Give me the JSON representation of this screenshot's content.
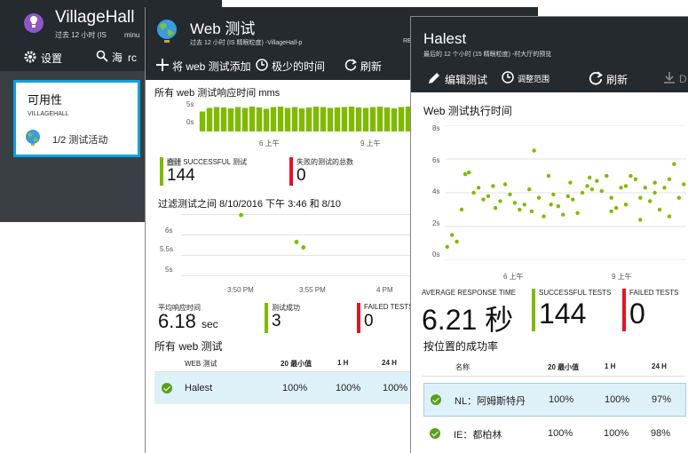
{
  "village": {
    "title": "VillageHall",
    "subtitle": "过去 12 小时 (IS",
    "subtitle2": "minu",
    "cmd_settings": "设置",
    "cmd_search": "海",
    "cmd_search_tail": "rc",
    "tile_title": "可用性",
    "tile_sub": "VILLAGEHALL",
    "tile_row": "1/2 测试活动"
  },
  "webtest": {
    "title": "Web 测试",
    "subtitle": "过去 12 小时 (IS 精眼粒度) -VillageHall-p",
    "subtitle_tail": "RE",
    "cmd_add": "将 web 测试添加",
    "cmd_time": "极少的时间",
    "cmd_refresh": "刷新",
    "chart1_title": "所有 web 测试响应时间 mms",
    "chart1_y": [
      "5s",
      "0s"
    ],
    "chart1_x": [
      "6 上午",
      "9 上午"
    ],
    "metric_success_label_a": "合计",
    "metric_success_label_b": "SUCCESSFUL 测试",
    "metric_success_value": "144",
    "metric_failed_label": "失败的测试的总数",
    "metric_failed_value": "0",
    "filter_title": "过滤测试之间 8/10/2016 下午 3:46 和 8/10",
    "chart2_y": [
      "6s",
      "5.5s",
      "5s"
    ],
    "chart2_x": [
      "3:50 PM",
      "3:55 PM",
      "4 PM"
    ],
    "avg_label": "平均响应时间",
    "avg_value": "6.18",
    "avg_unit": "sec",
    "succ_label": "测试成功",
    "succ_value": "3",
    "fail_label": "FAILED TESTS",
    "fail_value": "0",
    "all_tests_title": "所有 web 测试",
    "table_headers": [
      "WEB 测试",
      "20 最小值",
      "1 H",
      "24 H"
    ],
    "rows": [
      {
        "name": "Halest",
        "c1": "100%",
        "c2": "100%",
        "c3": "100%"
      }
    ]
  },
  "halest": {
    "title": "Halest",
    "subtitle": "最后的 12 个小时 (15 精眼粒度) -村大厅的预览",
    "cmd_edit": "编辑测试",
    "cmd_range": "调整范围",
    "cmd_refresh": "刷新",
    "cmd_download": "D",
    "chart_title": "Web 测试执行时间",
    "avg_label": "AVERAGE RESPONSE TIME",
    "avg_value": "6.21 秒",
    "succ_label": "SUCCESSFUL TESTS",
    "succ_value": "144",
    "fail_label": "FAILED TESTS",
    "fail_value": "0",
    "loc_title": "按位置的成功率",
    "table_headers": [
      "名称",
      "20 最小值",
      "1 H",
      "24 H"
    ],
    "rows": [
      {
        "name": "NL：阿姆斯特丹",
        "c1": "100%",
        "c2": "100%",
        "c3": "97%"
      },
      {
        "name": "IE：都柏林",
        "c1": "100%",
        "c2": "100%",
        "c3": "98%"
      }
    ]
  },
  "chart_data": [
    {
      "type": "bar",
      "title": "所有 web 测试响应时间 mms",
      "y_ticks": [
        "5s",
        "0s"
      ],
      "x_ticks": [
        "6 上午",
        "9 上午"
      ],
      "ylim": [
        0,
        8
      ],
      "values": [
        4.5,
        5.3,
        5.5,
        5.4,
        5.2,
        5.5,
        5.3,
        5.6,
        5.4,
        5.1,
        5.5,
        5.6,
        5.3,
        5.5,
        5.2,
        5.4,
        5.6,
        5.5,
        5.3,
        5.4,
        5.5,
        5.6,
        5.4,
        5.3,
        5.5,
        5.6,
        5.4,
        5.2,
        5.5,
        5.6
      ]
    },
    {
      "type": "scatter",
      "title": "过滤测试之间 8/10/2016 下午 3:46 和 8/10",
      "y_ticks": [
        "6s",
        "5.5s",
        "5s"
      ],
      "x_ticks": [
        "3:50 PM",
        "3:55 PM",
        "4 PM"
      ],
      "ylim": [
        4.8,
        6.2
      ],
      "points": [
        [
          0.26,
          6.05
        ],
        [
          0.5,
          5.55
        ],
        [
          0.53,
          5.45
        ]
      ]
    },
    {
      "type": "scatter",
      "title": "Web 测试执行时间",
      "y_ticks": [
        "8s",
        "6s",
        "4s",
        "2s",
        "0s"
      ],
      "x_ticks": [
        "6 上午",
        "9 上午"
      ],
      "ylim": [
        0,
        8
      ],
      "points": [
        [
          0.01,
          0.8
        ],
        [
          0.03,
          1.5
        ],
        [
          0.05,
          1.1
        ],
        [
          0.07,
          3.0
        ],
        [
          0.085,
          5.1
        ],
        [
          0.1,
          5.2
        ],
        [
          0.12,
          4.0
        ],
        [
          0.14,
          4.3
        ],
        [
          0.16,
          3.6
        ],
        [
          0.18,
          3.8
        ],
        [
          0.2,
          4.4
        ],
        [
          0.21,
          3.1
        ],
        [
          0.23,
          3.5
        ],
        [
          0.25,
          4.5
        ],
        [
          0.27,
          3.9
        ],
        [
          0.29,
          3.4
        ],
        [
          0.31,
          3.0
        ],
        [
          0.33,
          3.3
        ],
        [
          0.35,
          4.2
        ],
        [
          0.37,
          6.5
        ],
        [
          0.39,
          3.7
        ],
        [
          0.41,
          2.6
        ],
        [
          0.43,
          5.0
        ],
        [
          0.45,
          3.9
        ],
        [
          0.47,
          3.2
        ],
        [
          0.49,
          2.7
        ],
        [
          0.51,
          3.8
        ],
        [
          0.53,
          3.6
        ],
        [
          0.55,
          2.8
        ],
        [
          0.57,
          4.0
        ],
        [
          0.59,
          4.4
        ],
        [
          0.61,
          4.2
        ],
        [
          0.63,
          4.7
        ],
        [
          0.65,
          4.1
        ],
        [
          0.67,
          5.0
        ],
        [
          0.69,
          3.7
        ],
        [
          0.71,
          3.1
        ],
        [
          0.73,
          4.3
        ],
        [
          0.75,
          3.3
        ],
        [
          0.77,
          5.0
        ],
        [
          0.79,
          4.8
        ],
        [
          0.81,
          2.4
        ],
        [
          0.83,
          4.3
        ],
        [
          0.85,
          3.5
        ],
        [
          0.87,
          4.0
        ],
        [
          0.89,
          3.0
        ],
        [
          0.91,
          4.3
        ],
        [
          0.93,
          2.6
        ],
        [
          0.95,
          5.7
        ],
        [
          0.97,
          3.7
        ],
        [
          0.99,
          4.5
        ],
        [
          0.93,
          4.8
        ],
        [
          0.87,
          4.6
        ],
        [
          0.81,
          3.7
        ],
        [
          0.75,
          4.4
        ],
        [
          0.69,
          2.9
        ],
        [
          0.6,
          4.9
        ],
        [
          0.52,
          4.6
        ],
        [
          0.44,
          3.3
        ],
        [
          0.36,
          2.9
        ]
      ]
    }
  ]
}
